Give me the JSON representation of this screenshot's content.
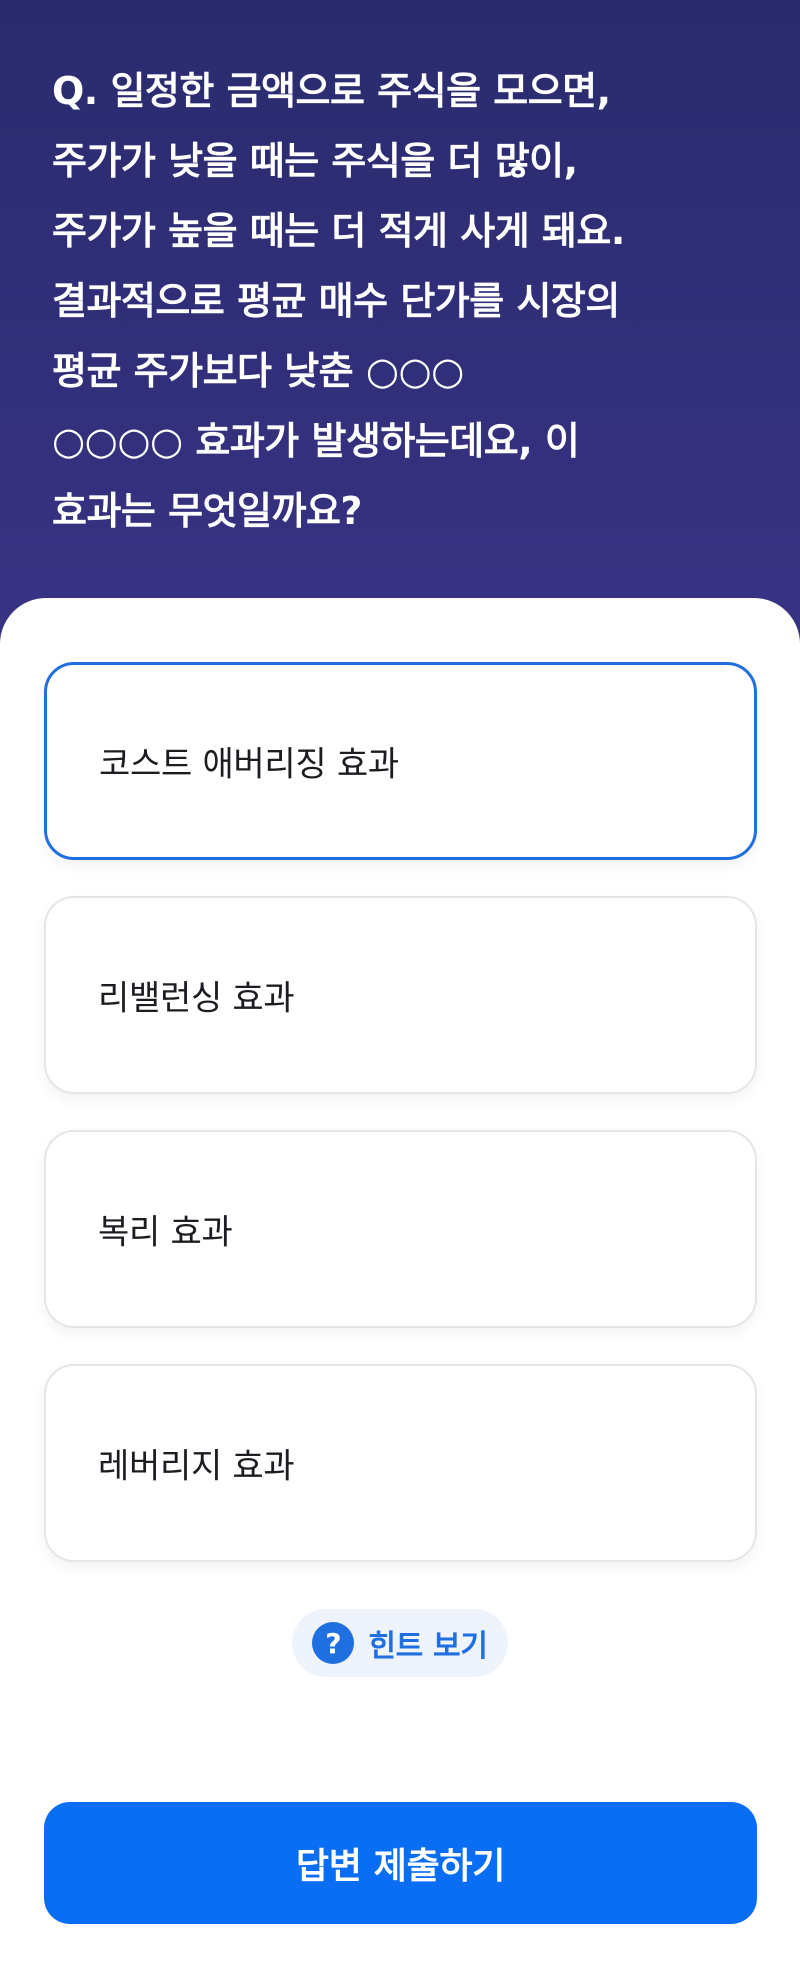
{
  "question": {
    "text": "Q. 일정한 금액으로 주식을 모으면,\n주가가 낮을 때는 주식을 더 많이,\n주가가 높을 때는 더 적게 사게 돼요.\n결과적으로 평균 매수 단가를 시장의\n평균 주가보다 낮춘 ○○○\n○○○○ 효과가 발생하는데요, 이\n효과는 무엇일까요?"
  },
  "options": [
    {
      "label": "코스트 애버리징 효과",
      "selected": true
    },
    {
      "label": "리밸런싱 효과",
      "selected": false
    },
    {
      "label": "복리 효과",
      "selected": false
    },
    {
      "label": "레버리지 효과",
      "selected": false
    }
  ],
  "hint": {
    "icon": "question-circle-icon",
    "icon_glyph": "?",
    "label": "힌트 보기"
  },
  "submit": {
    "label": "답변 제출하기"
  },
  "colors": {
    "accent": "#1f6fe0",
    "submit_bg": "#0a6ef5",
    "header_top": "#2a2b6e",
    "header_bottom": "#5540a8"
  }
}
